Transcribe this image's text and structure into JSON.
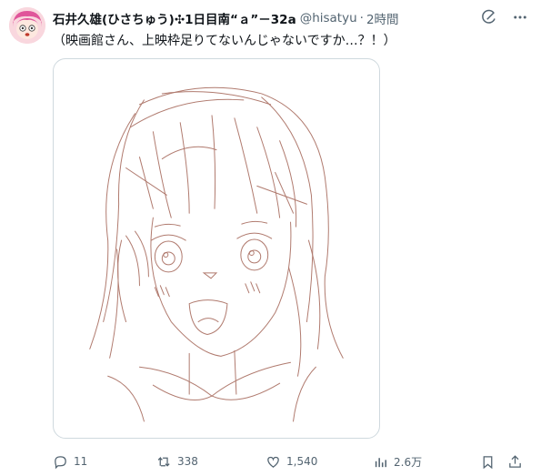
{
  "tweet": {
    "display_name": "石井久雄(ひさちゅう)✣1日目南“ａ”－32a",
    "handle": "@hisatyu",
    "separator": "·",
    "time": "2時間",
    "text": "（映画館さん、上映枠足りてないんじゃないですか…？！）",
    "media_alt_icon": "pencil-sketch-anime-girl"
  },
  "actions": {
    "reply_count": "11",
    "retweet_count": "338",
    "like_count": "1,540",
    "views_count": "2.6万"
  },
  "icons": {
    "grok": "grok-icon",
    "more": "more-icon",
    "reply": "reply-icon",
    "retweet": "retweet-icon",
    "like": "heart-icon",
    "views": "views-icon",
    "bookmark": "bookmark-icon",
    "share": "share-icon"
  },
  "colors": {
    "sketch_line": "#b07a6e",
    "secondary_text": "#536471",
    "avatar_bg": "#f7c6d0"
  }
}
